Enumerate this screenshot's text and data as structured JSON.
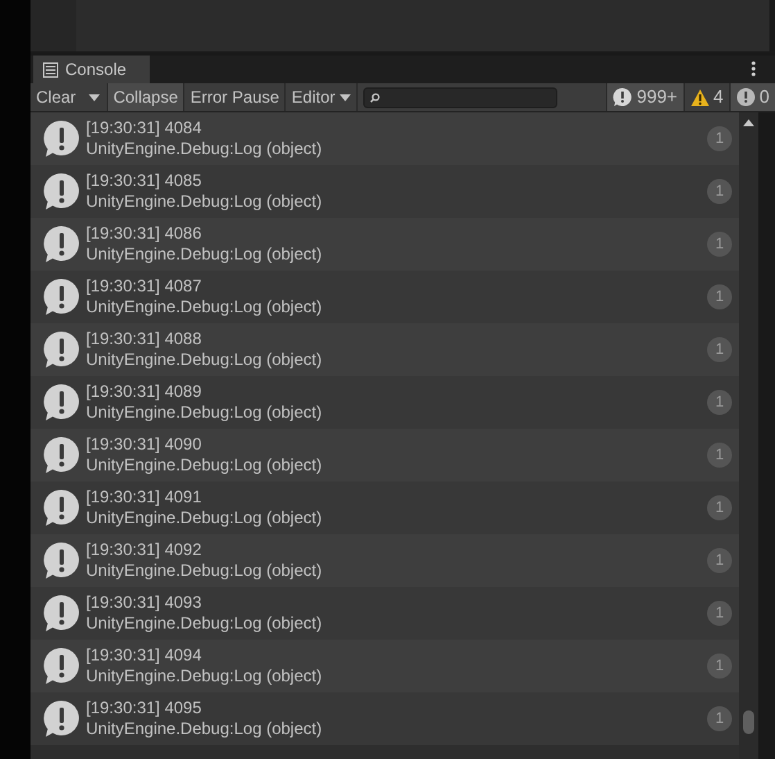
{
  "tab": {
    "label": "Console",
    "selected": true
  },
  "toolbar": {
    "buttons": [
      {
        "label": "Clear",
        "kind": "dropdown-split",
        "selected": false
      },
      {
        "label": "Collapse",
        "kind": "toggle",
        "selected": true
      },
      {
        "label": "Error Pause",
        "kind": "toggle",
        "selected": false
      },
      {
        "label": "Editor",
        "kind": "dropdown",
        "selected": false
      }
    ],
    "counters": [
      {
        "kind": "info",
        "count": "999+",
        "selected": true
      },
      {
        "kind": "warning",
        "count": "4",
        "selected": false
      },
      {
        "kind": "error",
        "count": "0",
        "selected": true
      }
    ]
  },
  "entries": [
    {
      "line1": "[19:30:31] 4084",
      "line2": "UnityEngine.Debug:Log (object)",
      "count": "1"
    },
    {
      "line1": "[19:30:31] 4085",
      "line2": "UnityEngine.Debug:Log (object)",
      "count": "1"
    },
    {
      "line1": "[19:30:31] 4086",
      "line2": "UnityEngine.Debug:Log (object)",
      "count": "1"
    },
    {
      "line1": "[19:30:31] 4087",
      "line2": "UnityEngine.Debug:Log (object)",
      "count": "1"
    },
    {
      "line1": "[19:30:31] 4088",
      "line2": "UnityEngine.Debug:Log (object)",
      "count": "1"
    },
    {
      "line1": "[19:30:31] 4089",
      "line2": "UnityEngine.Debug:Log (object)",
      "count": "1"
    },
    {
      "line1": "[19:30:31] 4090",
      "line2": "UnityEngine.Debug:Log (object)",
      "count": "1"
    },
    {
      "line1": "[19:30:31] 4091",
      "line2": "UnityEngine.Debug:Log (object)",
      "count": "1"
    },
    {
      "line1": "[19:30:31] 4092",
      "line2": "UnityEngine.Debug:Log (object)",
      "count": "1"
    },
    {
      "line1": "[19:30:31] 4093",
      "line2": "UnityEngine.Debug:Log (object)",
      "count": "1"
    },
    {
      "line1": "[19:30:31] 4094",
      "line2": "UnityEngine.Debug:Log (object)",
      "count": "1"
    },
    {
      "line1": "[19:30:31] 4095",
      "line2": "UnityEngine.Debug:Log (object)",
      "count": "1"
    }
  ]
}
